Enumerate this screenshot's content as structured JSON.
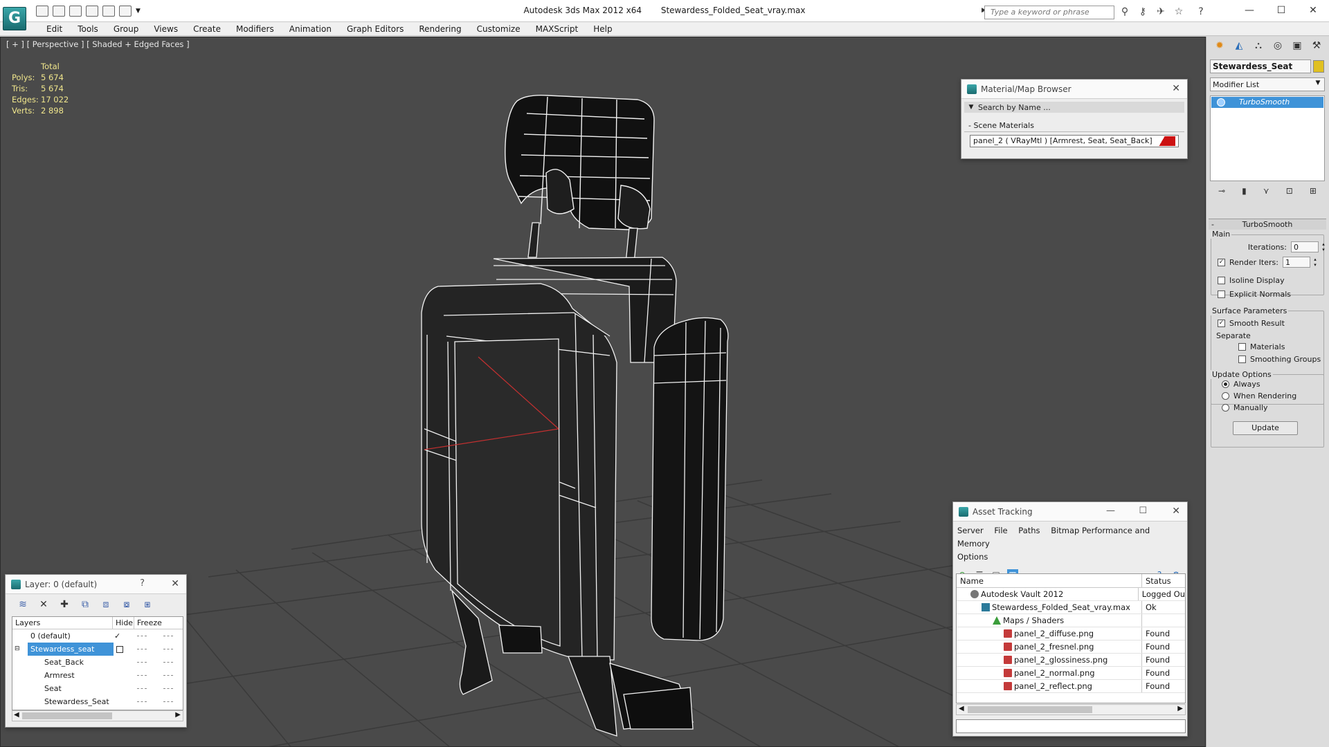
{
  "window": {
    "app_title": "Autodesk 3ds Max  2012 x64",
    "file_title": "Stewardess_Folded_Seat_vray.max",
    "search_placeholder": "Type a keyword or phrase",
    "logo_glyph": "G"
  },
  "menu": [
    "Edit",
    "Tools",
    "Group",
    "Views",
    "Create",
    "Modifiers",
    "Animation",
    "Graph Editors",
    "Rendering",
    "Customize",
    "MAXScript",
    "Help"
  ],
  "viewport": {
    "label": "[ + ] [ Perspective ] [ Shaded + Edged Faces ]",
    "stats_header": "Total",
    "stats": [
      {
        "label": "Polys:",
        "value": "5 674"
      },
      {
        "label": "Tris:",
        "value": "5 674"
      },
      {
        "label": "Edges:",
        "value": "17 022"
      },
      {
        "label": "Verts:",
        "value": "2 898"
      }
    ]
  },
  "material_browser": {
    "title": "Material/Map Browser",
    "search": "Search by Name ...",
    "section": "Scene Materials",
    "section_toggle": "-",
    "item": "panel_2  ( VRayMtl )  [Armrest, Seat, Seat_Back]"
  },
  "command_panel": {
    "object_name": "Stewardess_Seat",
    "modifier_list": "Modifier List",
    "stack_item": "TurboSmooth",
    "rollout": "TurboSmooth",
    "main_label": "Main",
    "iterations_label": "Iterations:",
    "iterations_value": "0",
    "render_iters_label": "Render Iters:",
    "render_iters_value": "1",
    "isoline": "Isoline Display",
    "explicit_normals": "Explicit Normals",
    "surface_params": "Surface Parameters",
    "smooth_result": "Smooth Result",
    "separate": "Separate",
    "materials": "Materials",
    "smoothing_groups": "Smoothing Groups",
    "update_options": "Update Options",
    "always": "Always",
    "when_rendering": "When Rendering",
    "manually": "Manually",
    "update_button": "Update"
  },
  "layer_panel": {
    "title": "Layer: 0 (default)",
    "help": "?",
    "columns": [
      "Layers",
      "Hide",
      "Freeze"
    ],
    "rows": [
      {
        "name": "0 (default)"
      },
      {
        "name": "Stewardess_seat"
      },
      {
        "name": "Seat_Back"
      },
      {
        "name": "Armrest"
      },
      {
        "name": "Seat"
      },
      {
        "name": "Stewardess_Seat"
      }
    ]
  },
  "asset_tracking": {
    "title": "Asset Tracking",
    "menus": [
      "Server",
      "File",
      "Paths",
      "Bitmap Performance and Memory",
      "Options"
    ],
    "columns": [
      "Name",
      "Status"
    ],
    "rows": [
      {
        "name": "Autodesk Vault 2012",
        "status": "Logged Ou"
      },
      {
        "name": "Stewardess_Folded_Seat_vray.max",
        "status": "Ok"
      },
      {
        "name": "Maps / Shaders",
        "status": ""
      },
      {
        "name": "panel_2_diffuse.png",
        "status": "Found"
      },
      {
        "name": "panel_2_fresnel.png",
        "status": "Found"
      },
      {
        "name": "panel_2_glossiness.png",
        "status": "Found"
      },
      {
        "name": "panel_2_normal.png",
        "status": "Found"
      },
      {
        "name": "panel_2_reflect.png",
        "status": "Found"
      }
    ]
  },
  "colors": {
    "selection": "#3f93d8",
    "viewport_bg": "#4a4a4a",
    "stats_text": "#f0e68c",
    "material_swatch": "#cc1111"
  }
}
